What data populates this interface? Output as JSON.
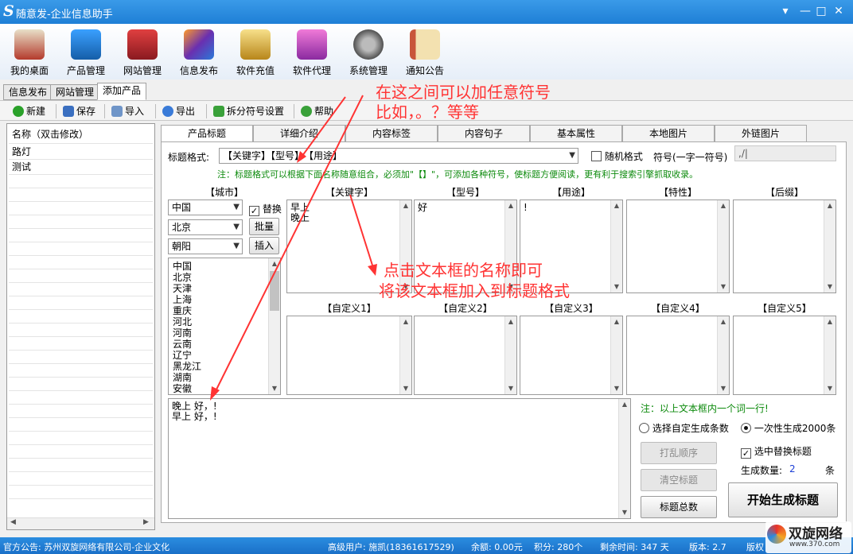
{
  "window": {
    "logo": "S",
    "title": "随意发-企业信息助手",
    "controls": [
      "▾",
      "—",
      "□",
      "✕"
    ]
  },
  "main_toolbar": [
    {
      "label": "我的桌面",
      "icon": "house-icon",
      "color": "#c0392b"
    },
    {
      "label": "产品管理",
      "icon": "cloud-icon",
      "color": "#1e73c8"
    },
    {
      "label": "网站管理",
      "icon": "building-icon",
      "color": "#b3222a"
    },
    {
      "label": "信息发布",
      "icon": "magic-wand-icon",
      "color": "#6a2fb0"
    },
    {
      "label": "软件充值",
      "icon": "coins-icon",
      "color": "#d7a22a"
    },
    {
      "label": "软件代理",
      "icon": "gift-icon",
      "color": "#c23aa8"
    },
    {
      "label": "系统管理",
      "icon": "gear-icon",
      "color": "#555555"
    },
    {
      "label": "通知公告",
      "icon": "notebook-icon",
      "color": "#d6b25a"
    }
  ],
  "tabs": [
    "信息发布",
    "网站管理",
    "添加产品"
  ],
  "action_toolbar": {
    "new": "新建",
    "save": "保存",
    "import": "导入",
    "export": "导出",
    "split": "拆分符号设置",
    "help": "帮助"
  },
  "left_list": {
    "header": "名称（双击修改）",
    "items": [
      "路灯",
      "测试"
    ]
  },
  "right_tabs": [
    "产品标题",
    "详细介绍",
    "内容标签",
    "内容句子",
    "基本属性",
    "本地图片",
    "外链图片"
  ],
  "title_format": {
    "label": "标题格式:",
    "value": "【关键字】【型号】，【用途】",
    "random_label": "随机格式",
    "symbol_label": "符号(一字一符号)",
    "symbol_value": ",/|",
    "note": "注：标题格式可以根据下面名称随意组合，必须加\"【】\"，可添加各种符号，使标题方便阅读，更有利于搜索引擎抓取收录。"
  },
  "city": {
    "header": "【城市】",
    "province": "中国",
    "city": "北京",
    "district": "朝阳",
    "replace_label": "替换",
    "batch_label": "批量",
    "insert_label": "插入",
    "list": [
      "中国",
      "北京",
      "天津",
      "上海",
      "重庆",
      "河北",
      "河南",
      "云南",
      "辽宁",
      "黑龙江",
      "湖南",
      "安徽"
    ]
  },
  "row1_headers": [
    "【关键字】",
    "【型号】",
    "【用途】",
    "【特性】",
    "【后缀】"
  ],
  "row1_contents": [
    "早上\n晚上",
    "好",
    "!",
    "",
    ""
  ],
  "row2_headers": [
    "【自定义1】",
    "【自定义2】",
    "【自定义3】",
    "【自定义4】",
    "【自定义5】"
  ],
  "output_text": "晚上 好，!\n早上 好，!",
  "options": {
    "note": "注：以上文本框内一个词一行!",
    "custom_count": "选择自定生成条数",
    "once_generate": "一次性生成2000条",
    "replace_selected": "选中替换标题",
    "shuffle": "打乱顺序",
    "clear": "清空标题",
    "total": "标题总数",
    "count_label": "生成数量:",
    "count_value": "2",
    "count_unit": "条",
    "start": "开始生成标题"
  },
  "annotations": {
    "top1": "在这之间可以加任意符号",
    "top2": "比如，。？等等",
    "mid1": "点击文本框的名称即可",
    "mid2": "将该文本框加入到标题格式"
  },
  "status": {
    "notice": "官方公告: 苏州双旋网络有限公司-企业文化",
    "user": "高级用户: 施凯(18361617529)",
    "balance": "余额: 0.00元",
    "points": "积分: 280个",
    "remaining": "剩余时间: 347 天",
    "version": "版本: 2.7",
    "rights": "版权"
  },
  "watermark": {
    "brand": "双旋网络",
    "domain": "www.370.com"
  },
  "colors": {
    "titlebar": "#1e7fd6",
    "accent_red": "#ff3333",
    "note_green": "#0c8a0c"
  }
}
